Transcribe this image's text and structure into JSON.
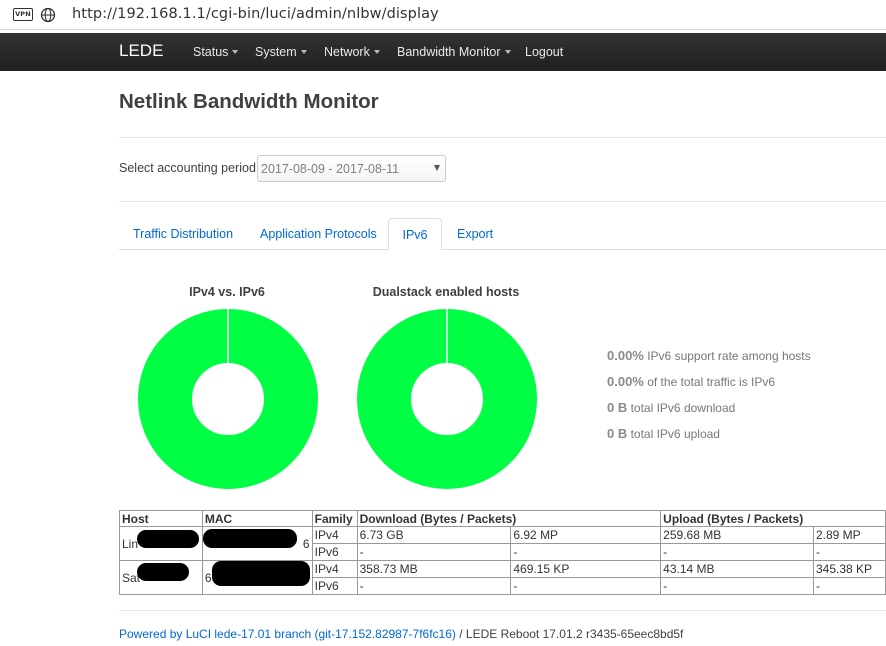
{
  "browser": {
    "vpn_label": "VPN",
    "url": "http://192.168.1.1/cgi-bin/luci/admin/nlbw/display"
  },
  "navbar": {
    "brand": "LEDE",
    "items": [
      {
        "label": "Status",
        "has_caret": true
      },
      {
        "label": "System",
        "has_caret": true
      },
      {
        "label": "Network",
        "has_caret": true
      },
      {
        "label": "Bandwidth Monitor",
        "has_caret": true
      },
      {
        "label": "Logout",
        "has_caret": false
      }
    ]
  },
  "page": {
    "title": "Netlink Bandwidth Monitor",
    "period_label": "Select accounting period:",
    "period_value": "2017-08-09 - 2017-08-11"
  },
  "tabs": [
    {
      "label": "Traffic Distribution",
      "active": false
    },
    {
      "label": "Application Protocols",
      "active": false
    },
    {
      "label": "IPv6",
      "active": true
    },
    {
      "label": "Export",
      "active": false
    }
  ],
  "charts": {
    "color": "#00ff44",
    "ipv4_vs_ipv6": {
      "title": "IPv4 vs. IPv6"
    },
    "dualstack": {
      "title": "Dualstack enabled hosts"
    }
  },
  "stats": [
    {
      "value": "0.00%",
      "label": "IPv6 support rate among hosts"
    },
    {
      "value": "0.00%",
      "label": "of the total traffic is IPv6"
    },
    {
      "value": "0 B",
      "label": "total IPv6 download"
    },
    {
      "value": "0 B",
      "label": "total IPv6 upload"
    }
  ],
  "table": {
    "headers": {
      "host": "Host",
      "mac": "MAC",
      "family": "Family",
      "download": "Download (Bytes / Packets)",
      "upload": "Upload (Bytes / Packets)"
    },
    "rows": [
      {
        "host": "Lin",
        "mac": "6",
        "family": "IPv4",
        "dl_bytes": "6.73 GB",
        "dl_packets": "6.92 MP",
        "ul_bytes": "259.68 MB",
        "ul_packets": "2.89 MP"
      },
      {
        "host": "",
        "mac": "",
        "family": "IPv6",
        "dl_bytes": "-",
        "dl_packets": "-",
        "ul_bytes": "-",
        "ul_packets": "-"
      },
      {
        "host": "Sat",
        "mac": "6",
        "family": "IPv4",
        "dl_bytes": "358.73 MB",
        "dl_packets": "469.15 KP",
        "ul_bytes": "43.14 MB",
        "ul_packets": "345.38 KP"
      },
      {
        "host": "",
        "mac": "",
        "family": "IPv6",
        "dl_bytes": "-",
        "dl_packets": "-",
        "ul_bytes": "-",
        "ul_packets": "-"
      }
    ]
  },
  "footer": {
    "link_text": "Powered by LuCI lede-17.01 branch (git-17.152.82987-7f6fc16)",
    "suffix": " / LEDE Reboot 17.01.2 r3435-65eec8bd5f"
  }
}
